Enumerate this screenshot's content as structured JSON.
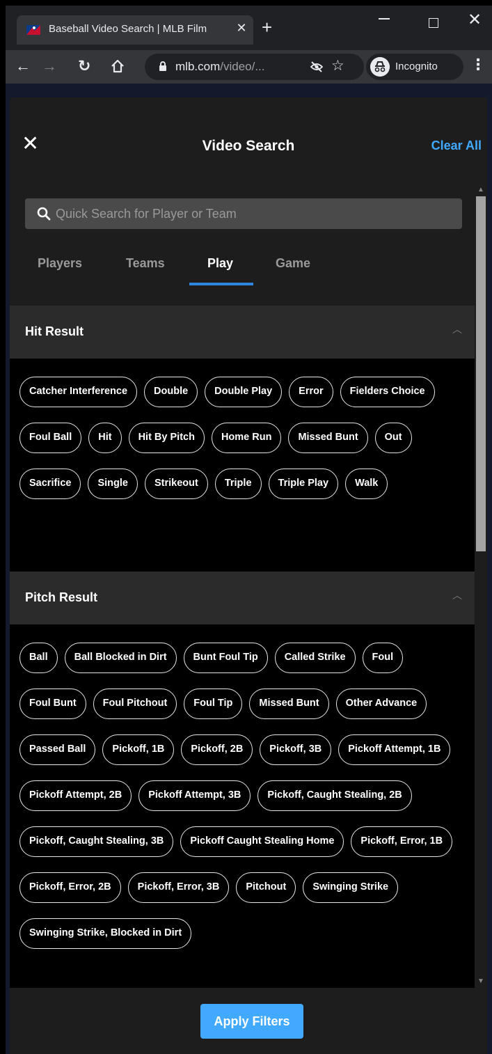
{
  "browser": {
    "tab_title": "Baseball Video Search | MLB Film",
    "tab_close": "✕",
    "new_tab": "+",
    "url_host": "mlb.com",
    "url_path": "/video/...",
    "incognito_label": "Incognito"
  },
  "panel": {
    "close": "✕",
    "title": "Video Search",
    "clear_all": "Clear All"
  },
  "search": {
    "placeholder": "Quick Search for Player or Team"
  },
  "tabs": [
    {
      "label": "Players",
      "active": false
    },
    {
      "label": "Teams",
      "active": false
    },
    {
      "label": "Play",
      "active": true
    },
    {
      "label": "Game",
      "active": false
    }
  ],
  "sections": [
    {
      "title": "Hit Result",
      "options": [
        "Catcher Interference",
        "Double",
        "Double Play",
        "Error",
        "Fielders Choice",
        "Foul Ball",
        "Hit",
        "Hit By Pitch",
        "Home Run",
        "Missed Bunt",
        "Out",
        "Sacrifice",
        "Single",
        "Strikeout",
        "Triple",
        "Triple Play",
        "Walk"
      ]
    },
    {
      "title": "Pitch Result",
      "options": [
        "Ball",
        "Ball Blocked in Dirt",
        "Bunt Foul Tip",
        "Called Strike",
        "Foul",
        "Foul Bunt",
        "Foul Pitchout",
        "Foul Tip",
        "Missed Bunt",
        "Other Advance",
        "Passed Ball",
        "Pickoff, 1B",
        "Pickoff, 2B",
        "Pickoff, 3B",
        "Pickoff Attempt, 1B",
        "Pickoff Attempt, 2B",
        "Pickoff Attempt, 3B",
        "Pickoff, Caught Stealing, 2B",
        "Pickoff, Caught Stealing, 3B",
        "Pickoff Caught Stealing Home",
        "Pickoff, Error, 1B",
        "Pickoff, Error, 2B",
        "Pickoff, Error, 3B",
        "Pitchout",
        "Swinging Strike",
        "Swinging Strike, Blocked in Dirt"
      ]
    }
  ],
  "footer": {
    "apply_label": "Apply Filters"
  },
  "colors": {
    "accent": "#41a9ff",
    "tab_underline": "#2e86de",
    "panel_bg": "#1d1d1d"
  }
}
